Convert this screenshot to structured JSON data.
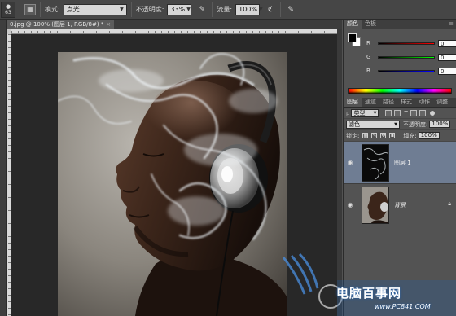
{
  "options_bar": {
    "tool_preset_size": "63",
    "mode_label": "模式:",
    "mode_value": "点光",
    "opacity_label": "不透明度:",
    "opacity_value": "33%",
    "flow_label": "流量:",
    "flow_value": "100%"
  },
  "document": {
    "tab_title": "0.jpg @ 100% (图层 1, RGB/8#) *",
    "close_glyph": "×"
  },
  "color_panel": {
    "tabs": [
      "颜色",
      "色板"
    ],
    "channels": [
      {
        "label": "R",
        "value": "0",
        "color": "#e23a3a"
      },
      {
        "label": "G",
        "value": "0",
        "color": "#36c236"
      },
      {
        "label": "B",
        "value": "0",
        "color": "#3a5ae2"
      }
    ],
    "foreground": "#000000",
    "background": "#ffffff"
  },
  "layers_panel": {
    "tabs": [
      "图层",
      "通道",
      "路径",
      "样式",
      "动作",
      "调整"
    ],
    "filter_kind": "类型",
    "blend_mode": "滤色",
    "opacity_label": "不透明度:",
    "opacity_value": "100%",
    "lock_label": "锁定:",
    "fill_label": "填充:",
    "fill_value": "100%",
    "layers": [
      {
        "name": "图层 1",
        "selected": true
      },
      {
        "name": "背景",
        "locked": true
      }
    ]
  },
  "watermark": {
    "site_name": "电脑百事网",
    "url": "www.PC841.COM"
  },
  "colors": {
    "app_bg": "#535353",
    "selection": "#6f7d93",
    "brand_blue": "#1d5fb0"
  }
}
